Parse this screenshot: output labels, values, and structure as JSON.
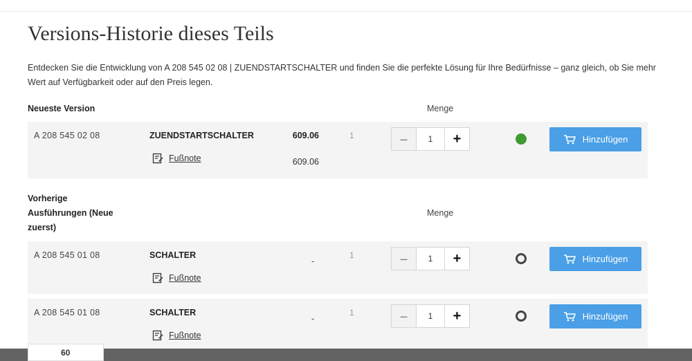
{
  "page": {
    "title": "Versions-Historie dieses Teils",
    "intro": "Entdecken Sie die Entwicklung von A 208 545 02 08 | ZUENDSTARTSCHALTER und finden Sie die perfekte Lösung für Ihre Bedürfnisse – ganz gleich, ob Sie mehr Wert auf Verfügbarkeit oder auf den Preis legen."
  },
  "newest": {
    "heading": "Neueste Version",
    "menge_label": "Menge",
    "row": {
      "part_number": "A 208 545 02 08",
      "name": "ZUENDSTARTSCHALTER",
      "footnote": "Fußnote",
      "price": "609.06",
      "price_sub": "609.06",
      "qty_label": "1",
      "quantity": "1",
      "availability": "available",
      "add_label": "Hinzufügen"
    }
  },
  "previous": {
    "heading": "Vorherige Ausführungen (Neue zuerst)",
    "menge_label": "Menge",
    "rows": [
      {
        "part_number": "A 208 545 01 08",
        "name": "SCHALTER",
        "footnote": "Fußnote",
        "price": "-",
        "qty_label": "1",
        "quantity": "1",
        "availability": "unknown",
        "add_label": "Hinzufügen"
      },
      {
        "part_number": "A 208 545 01 08",
        "name": "SCHALTER",
        "footnote": "Fußnote",
        "price": "-",
        "qty_label": "1",
        "quantity": "1",
        "availability": "unknown",
        "add_label": "Hinzufügen"
      }
    ]
  },
  "peek": {
    "value": "60"
  },
  "colors": {
    "accent": "#4a9fe6",
    "available": "#3f9a32",
    "row_bg": "#f4f4f4"
  }
}
